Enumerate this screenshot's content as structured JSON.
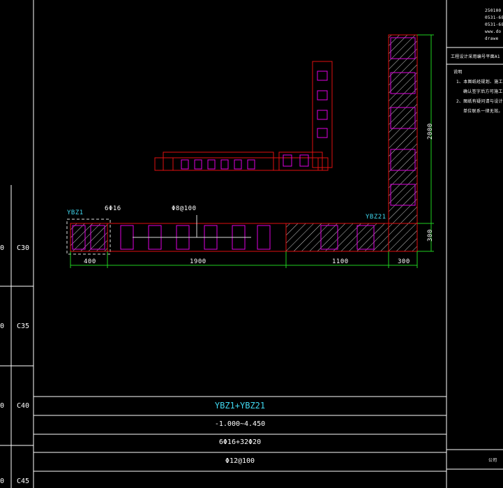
{
  "left_column": {
    "zeros": [
      "0",
      "0",
      "0",
      "0"
    ],
    "grades": [
      "C30",
      "C35",
      "C40",
      "C45"
    ]
  },
  "drawing": {
    "labels": {
      "ybz1_left": "YBZ1",
      "ybz21_right": "YBZ21",
      "rebar_top": "6Φ16",
      "stirrup": "Φ8@100"
    },
    "dimensions": {
      "horizontal": [
        "400",
        "1900",
        "1100",
        "300"
      ],
      "vertical": [
        "2000",
        "300"
      ]
    }
  },
  "table": {
    "title": "YBZ1+YBZ21",
    "row_elevation": "-1.000~4.450",
    "row_longitudinal": "6Φ16+32Φ20",
    "row_stirrup": "Φ12@100"
  },
  "title_block": {
    "contact": [
      "250100",
      "0531-68",
      "0531-68",
      "www.do",
      "drawe"
    ],
    "project": "工程设计采用编号平面A1",
    "notes_heading": "说明",
    "notes": [
      "1、本图纸经规划、施工",
      "确认签字后方可施工",
      "2、图纸有疑问请与设计",
      "单位联系一律无效。"
    ],
    "bottom_label": "公司"
  }
}
